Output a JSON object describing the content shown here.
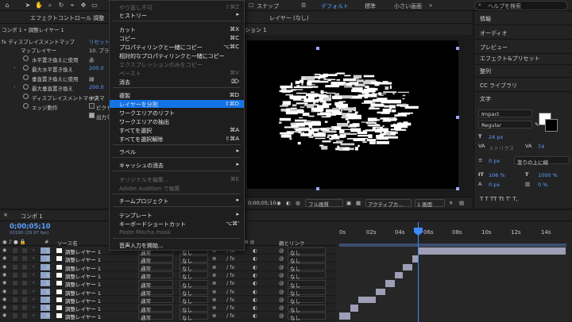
{
  "topbar": {
    "workspaces": [
      "デフォルト",
      "標準",
      "小さい画面"
    ],
    "help_placeholder": "ヘルプを検索",
    "snap_label": "スナップ"
  },
  "effect_controls": {
    "tab_title": "エフェクトコントロール 調整",
    "breadcrumb": "コンポ 1 • 調整レイヤー 1",
    "rows": [
      {
        "label": "fx  ディスプレイスメントマップ",
        "value": "リセット"
      },
      {
        "label": "マップレイヤー",
        "value": "10. ブラ"
      },
      {
        "label": "水平置き換えに使用",
        "value": "赤"
      },
      {
        "label": "最大水平置き換え",
        "value": "200.0"
      },
      {
        "label": "垂直置き換えに使用",
        "value": "緑"
      },
      {
        "label": "最大垂直置き換え",
        "value": "200.0"
      },
      {
        "label": "ディスプレイスメントマップ",
        "value": "中央マ"
      },
      {
        "label": "エッジ動作",
        "value": "ピクセル"
      },
      {
        "label": "",
        "value": "出力を"
      }
    ]
  },
  "menu": {
    "items": [
      {
        "label": "やり直し不可",
        "key": "⇧⌘Z",
        "disabled": true
      },
      {
        "label": "ヒストリー",
        "submenu": true
      },
      {
        "label": "カット",
        "key": "⌘X"
      },
      {
        "label": "コピー",
        "key": "⌘C"
      },
      {
        "label": "プロパティリンクと一緒にコピー",
        "key": "⌥⌘C"
      },
      {
        "label": "相対的なプロパティリンクと一緒にコピー"
      },
      {
        "label": "エクスプレッションのみをコピー",
        "disabled": true
      },
      {
        "label": "ペースト",
        "key": "⌘V",
        "disabled": true
      },
      {
        "label": "消去",
        "key": "⌦"
      },
      {
        "label": "複製",
        "key": "⌘D"
      },
      {
        "label": "レイヤーを分割",
        "key": "⇧⌘D",
        "highlighted": true
      },
      {
        "label": "ワークエリアのリフト"
      },
      {
        "label": "ワークエリアの抽出"
      },
      {
        "label": "すべてを選択",
        "key": "⌘A"
      },
      {
        "label": "すべてを選択解除",
        "key": "⇧⌘A"
      },
      {
        "label": "ラベル",
        "submenu": true
      },
      {
        "label": "キャッシュの消去",
        "submenu": true
      },
      {
        "label": "オリジナルを編集...",
        "key": "⌘E",
        "disabled": true
      },
      {
        "label": "Adobe Audition で編集",
        "disabled": true
      },
      {
        "label": "チームプロジェクト",
        "submenu": true
      },
      {
        "label": "テンプレート",
        "submenu": true
      },
      {
        "label": "キーボードショートカット",
        "key": "⌥⌘'"
      },
      {
        "label": "Paste Mocha mask",
        "disabled": true
      },
      {
        "label": "音声入力を開始..."
      }
    ]
  },
  "viewer": {
    "tab_layer": "レイヤー (なし)",
    "sub_label": "ション 1",
    "footer": {
      "time": "0;00;05;10",
      "quality": "フル画質",
      "camera": "アクティブカ...",
      "views": "1 画面"
    }
  },
  "right_panel": {
    "items": [
      "情報",
      "オーディオ",
      "プレビュー",
      "エフェクト&プリセット",
      "整列",
      "CC ライブラリ"
    ],
    "text": {
      "title": "文字",
      "font": "Impact",
      "style": "Regular",
      "size": "24 px",
      "tracking_label": "メトリクス",
      "tracking_value": "74",
      "stroke_width": "0 px",
      "stroke_mode": "塗りの上に線",
      "vscale": "106 %",
      "hscale": "1000 %",
      "baseline": "0 px",
      "tsume": "0 %",
      "glyphs": "T  T  TT  Tt  T'  T,"
    }
  },
  "timeline": {
    "comp_name": "コンポ 1",
    "timecode": "0;00;05;10",
    "timecode_sub": "00160 (29.97 fps)",
    "headers": {
      "source": "ソース名",
      "parent": "親とリンク"
    },
    "ruler_labels": [
      "0s",
      "02s",
      "04s",
      "06s",
      "08s",
      "10s",
      "12s",
      "14s"
    ],
    "layers": [
      {
        "num": "1",
        "name": "調整レイヤー 1",
        "mode": "通常",
        "track": "なし",
        "parent": "なし"
      },
      {
        "num": "2",
        "name": "調整レイヤー 1",
        "mode": "通常",
        "track": "なし",
        "parent": "なし"
      },
      {
        "num": "3",
        "name": "調整レイヤー 1",
        "mode": "通常",
        "track": "なし",
        "parent": "なし"
      },
      {
        "num": "4",
        "name": "調整レイヤー 1",
        "mode": "通常",
        "track": "なし",
        "parent": "なし"
      },
      {
        "num": "5",
        "name": "調整レイヤー 1",
        "mode": "通常",
        "track": "なし",
        "parent": "なし"
      },
      {
        "num": "6",
        "name": "調整レイヤー 1",
        "mode": "通常",
        "track": "なし",
        "parent": "なし"
      },
      {
        "num": "7",
        "name": "調整レイヤー 1",
        "mode": "通常",
        "track": "なし",
        "parent": "なし"
      },
      {
        "num": "8",
        "name": "調整レイヤー 1",
        "mode": "通常",
        "track": "なし",
        "parent": "なし"
      },
      {
        "num": "9",
        "name": "調整レイヤー 1",
        "mode": "通常",
        "track": "なし",
        "parent": "なし"
      }
    ]
  }
}
